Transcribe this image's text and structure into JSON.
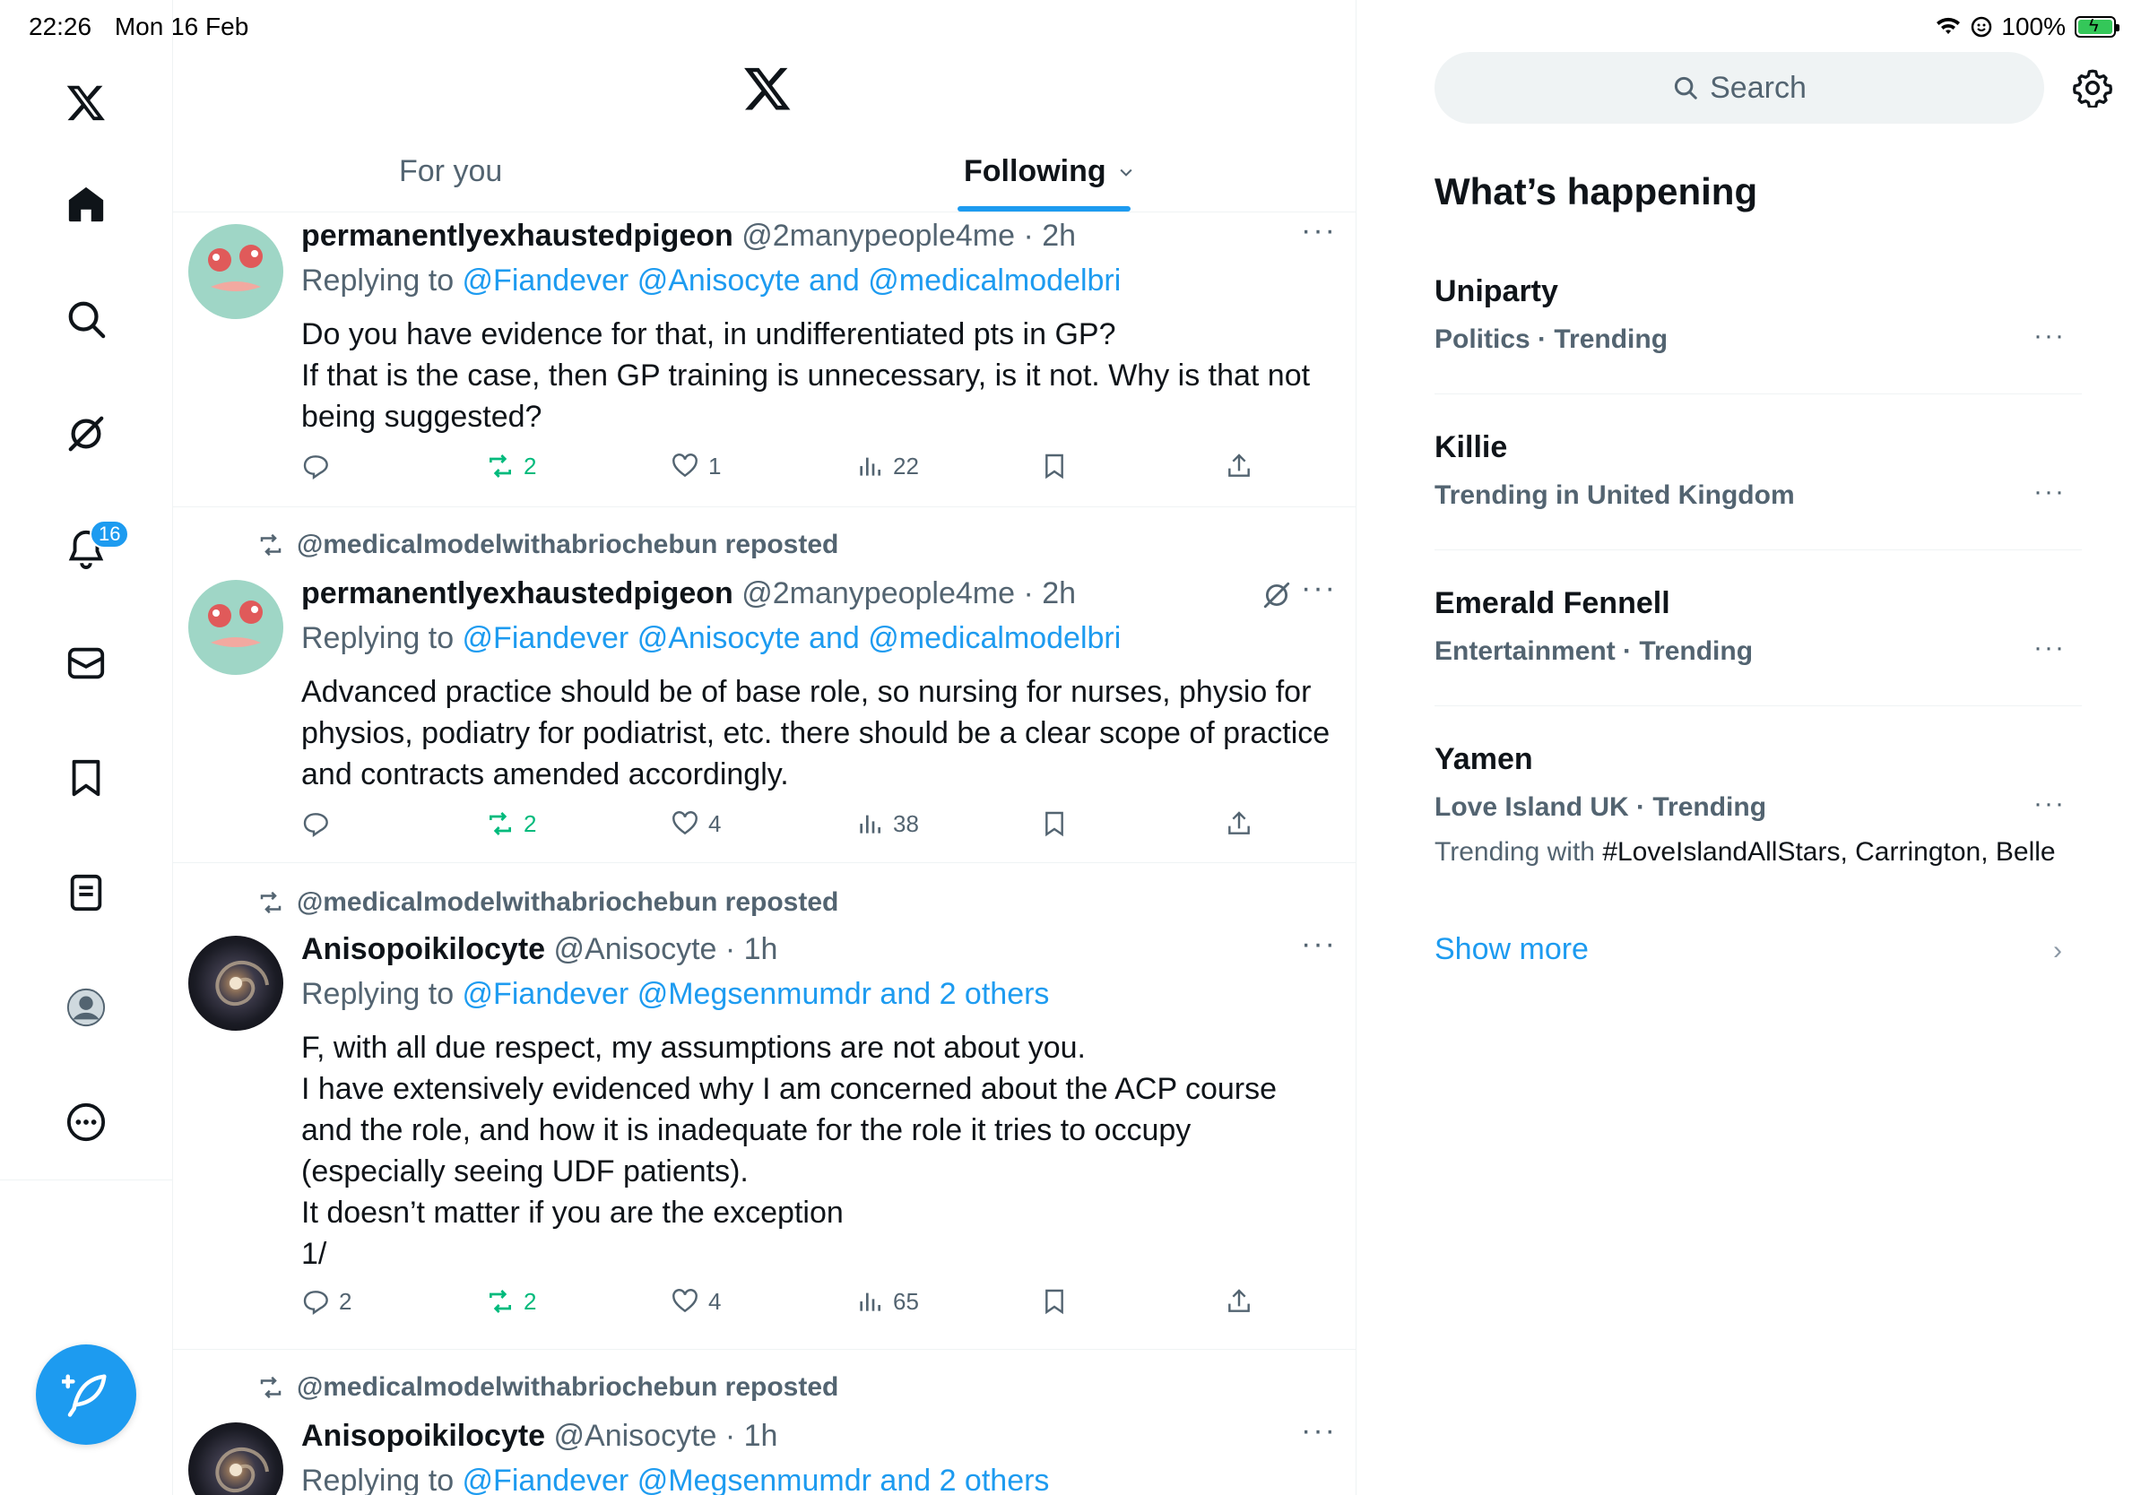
{
  "status_bar": {
    "time": "22:26",
    "date": "Mon 16 Feb",
    "battery": "100%",
    "battery_level": 1.0
  },
  "nav": {
    "items": [
      "x-logo",
      "home",
      "explore",
      "grok",
      "notifications",
      "messages",
      "bookmarks",
      "lists",
      "profile",
      "more"
    ],
    "notifications_count": "16"
  },
  "header": {
    "tabs": [
      {
        "label": "For you",
        "selected": false
      },
      {
        "label": "Following",
        "selected": true
      }
    ]
  },
  "tweets": [
    {
      "reposted_by": "",
      "name": "permanentlyexhaustedpigeon",
      "handle_time": "@2manypeople4me · 2h",
      "replying_prefix": "Replying to ",
      "replying_to": "@Fiandever @Anisocyte and @medicalmodelbri",
      "text": "Do you have evidence for that, in undifferentiated pts in GP?\nIf that is the case, then GP training is unnecessary, is it not. Why is that not being suggested?",
      "replies": "",
      "reposts": "2",
      "likes": "1",
      "views": "22"
    },
    {
      "reposted_by": "@medicalmodelwithabriochebun reposted",
      "name": "permanentlyexhaustedpigeon",
      "handle_time": "@2manypeople4me · 2h",
      "replying_prefix": "Replying to ",
      "replying_to": "@Fiandever @Anisocyte and @medicalmodelbri",
      "text": "Advanced practice should be of base role, so nursing for nurses, physio for physios, podiatry for podiatrist, etc. there should be a clear scope of practice and contracts amended accordingly.",
      "replies": "",
      "reposts": "2",
      "likes": "4",
      "views": "38"
    },
    {
      "reposted_by": "@medicalmodelwithabriochebun reposted",
      "name": "Anisopoikilocyte",
      "handle_time": "@Anisocyte · 1h",
      "replying_prefix": "Replying to ",
      "replying_to": "@Fiandever @Megsenmumdr and 2 others",
      "text": "F, with all due respect, my assumptions are not about you.\nI have extensively evidenced why I am concerned about the ACP course and the role, and how it is inadequate for the role it tries to occupy (especially seeing UDF patients).\nIt doesn’t matter if you are the exception\n1/",
      "replies": "2",
      "reposts": "2",
      "likes": "4",
      "views": "65"
    },
    {
      "reposted_by": "@medicalmodelwithabriochebun reposted",
      "name": "Anisopoikilocyte",
      "handle_time": "@Anisocyte · 1h",
      "replying_prefix": "Replying to ",
      "replying_to": "@Fiandever @Megsenmumdr and 2 others",
      "text": ""
    }
  ],
  "sidebar": {
    "search_placeholder": "Search",
    "title": "What’s happening",
    "trends": [
      {
        "name": "Uniparty",
        "meta": "Politics · Trending"
      },
      {
        "name": "Killie",
        "meta": "Trending in United Kingdom"
      },
      {
        "name": "Emerald Fennell",
        "meta": "Entertainment · Trending"
      },
      {
        "name": "Yamen",
        "meta": "Love Island UK · Trending",
        "with_prefix": "Trending with ",
        "with_tags": "#LoveIslandAllStars, Carrington, Belle"
      }
    ],
    "show_more": "Show more"
  },
  "colors": {
    "accent": "#1d9bf0",
    "repost_green": "#00ba7c",
    "secondary_text": "#536471"
  }
}
